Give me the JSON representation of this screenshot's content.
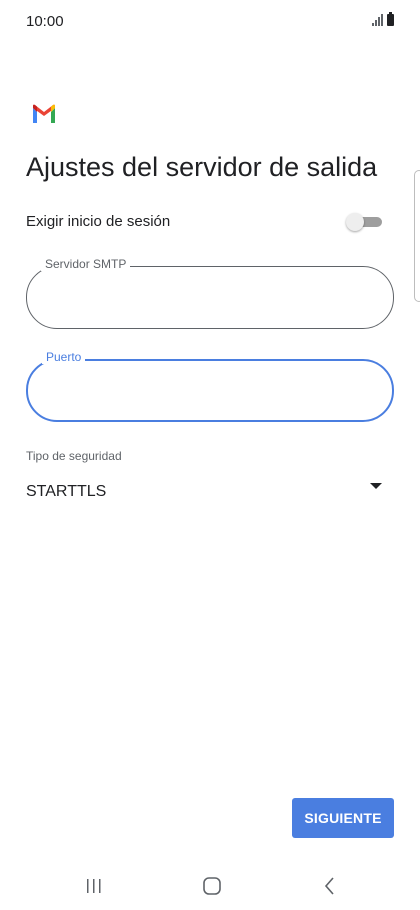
{
  "status_bar": {
    "time": "10:00",
    "signal_icon": "signal-bars-icon",
    "battery_icon": "battery-icon"
  },
  "app": {
    "logo_icon": "gmail-logo-icon",
    "title": "Ajustes del servidor de salida"
  },
  "form": {
    "require_signin": {
      "label": "Exigir inicio de sesión",
      "enabled": false
    },
    "smtp_server": {
      "label": "Servidor SMTP",
      "value": ""
    },
    "port": {
      "label": "Puerto",
      "value": "",
      "focused": true
    },
    "security_type": {
      "label": "Tipo de seguridad",
      "selected": "STARTTLS",
      "arrow_icon": "dropdown-arrow-icon"
    }
  },
  "actions": {
    "next_label": "SIGUIENTE"
  },
  "nav_bar": {
    "recent_icon": "recent-apps-icon",
    "home_icon": "home-icon",
    "back_icon": "back-icon"
  },
  "colors": {
    "accent": "#4a7ee0",
    "gmail_red": "#EA4335",
    "gmail_blue": "#4285F4",
    "gmail_green": "#34A853",
    "gmail_yellow": "#FBBC04",
    "toggle_track": "#9e9e9e"
  }
}
